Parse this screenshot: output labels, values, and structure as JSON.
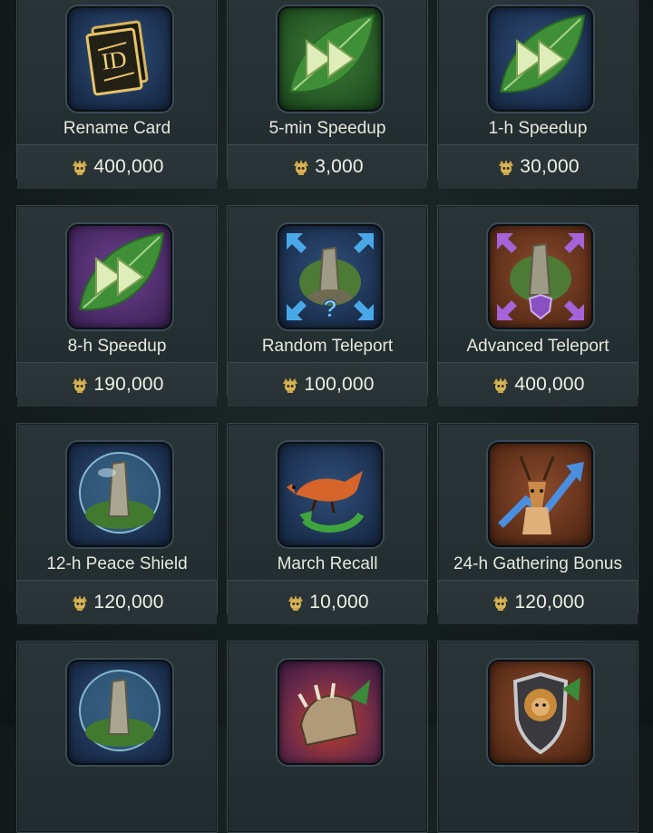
{
  "items": [
    {
      "name": "Rename Card",
      "price": "400,000",
      "icon": "rename-card-icon",
      "bg": "blue"
    },
    {
      "name": "5-min Speedup",
      "price": "3,000",
      "icon": "speedup-leaf-icon",
      "bg": "green"
    },
    {
      "name": "1-h Speedup",
      "price": "30,000",
      "icon": "speedup-leaf-icon",
      "bg": "blue"
    },
    {
      "name": "8-h Speedup",
      "price": "190,000",
      "icon": "speedup-leaf-icon",
      "bg": "purple"
    },
    {
      "name": "Random Teleport",
      "price": "100,000",
      "icon": "random-teleport-icon",
      "bg": "blue"
    },
    {
      "name": "Advanced Teleport",
      "price": "400,000",
      "icon": "advanced-teleport-icon",
      "bg": "brown"
    },
    {
      "name": "12-h Peace Shield",
      "price": "120,000",
      "icon": "peace-shield-icon",
      "bg": "blue"
    },
    {
      "name": "March Recall",
      "price": "10,000",
      "icon": "march-recall-icon",
      "bg": "blue"
    },
    {
      "name": "24-h Gathering Bonus",
      "price": "120,000",
      "icon": "gathering-bonus-icon",
      "bg": "brown"
    },
    {
      "name": "",
      "price": "",
      "icon": "peace-shield-icon",
      "bg": "blue"
    },
    {
      "name": "",
      "price": "",
      "icon": "claw-attack-icon",
      "bg": "purple"
    },
    {
      "name": "",
      "price": "",
      "icon": "lion-shield-icon",
      "bg": "brown"
    }
  ],
  "currency_icon": "skull-coin-icon",
  "colors": {
    "label": "#e6e8de",
    "price": "#eef0e6",
    "coin": "#c9a64a",
    "card_bg": "#253032"
  }
}
